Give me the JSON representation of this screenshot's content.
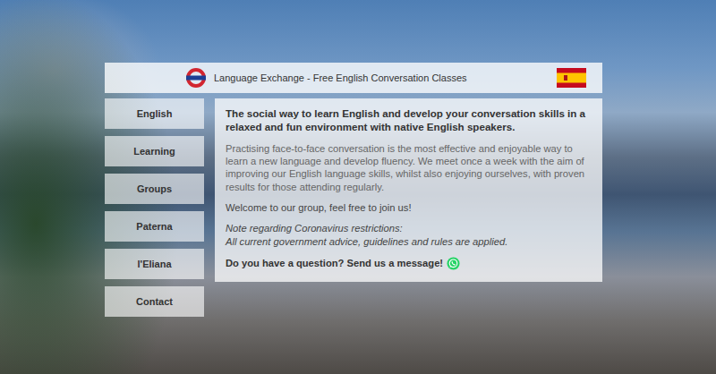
{
  "header": {
    "title": "Language Exchange - Free English Conversation Classes"
  },
  "sidebar": {
    "items": [
      {
        "label": "English"
      },
      {
        "label": "Learning"
      },
      {
        "label": "Groups"
      },
      {
        "label": "Paterna"
      },
      {
        "label": "l'Eliana"
      },
      {
        "label": "Contact"
      }
    ]
  },
  "content": {
    "headline": "The social way to learn English and develop your conversation skills in a relaxed and fun environment with native English speakers.",
    "paragraph": "Practising face-to-face conversation is the most effective and enjoyable way to learn a new language and develop fluency. We meet once a week with the aim of improving our English language skills, whilst also enjoying ourselves, with proven results for those attending regularly.",
    "welcome": "Welcome to our group, feel free to join us!",
    "note_title": "Note regarding Coronavirus restrictions:",
    "note_body": "All current government advice, guidelines and rules are applied.",
    "question": "Do you have a question? Send us a message!"
  }
}
